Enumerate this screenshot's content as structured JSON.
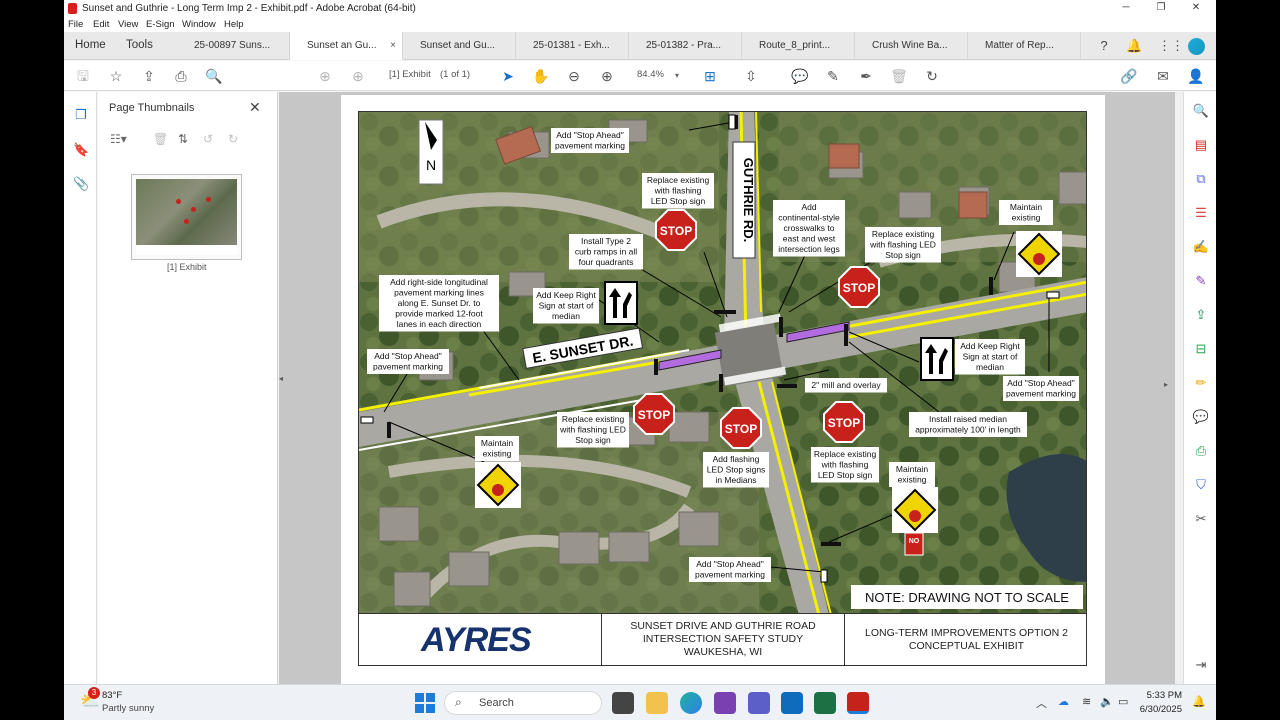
{
  "window": {
    "title": "Sunset and Guthrie - Long Term Imp 2 - Exhibit.pdf - Adobe Acrobat (64-bit)",
    "minimize": "─",
    "maximize": "❐",
    "close": "✕"
  },
  "menu": [
    "File",
    "Edit",
    "View",
    "E-Sign",
    "Window",
    "Help"
  ],
  "nav": {
    "home": "Home",
    "tools": "Tools"
  },
  "tabs": [
    {
      "label": "25-00897 Suns..."
    },
    {
      "label": "Sunset an Gu...",
      "active": true,
      "close": "×"
    },
    {
      "label": "Sunset and Gu..."
    },
    {
      "label": "25-01381 - Exh..."
    },
    {
      "label": "25-01382 - Pra..."
    },
    {
      "label": "Route_8_print..."
    },
    {
      "label": "Crush Wine Ba..."
    },
    {
      "label": "Matter of Rep..."
    }
  ],
  "toolbar": {
    "page_label": "[1] Exhibit",
    "page_count": "(1 of 1)",
    "zoom": "84.4%"
  },
  "thumbnails": {
    "header": "Page Thumbnails",
    "close": "✕",
    "caption": "[1] Exhibit"
  },
  "drawing": {
    "north": "N",
    "road_ns": "GUTHRIE RD.",
    "road_ew": "E. SUNSET DR.",
    "stop": "STOP",
    "no_label": "NO",
    "note": "NOTE: DRAWING NOT TO SCALE",
    "callouts": {
      "stop_ahead_top": [
        "Add \"Stop Ahead\"",
        "pavement marking"
      ],
      "replace_top": [
        "Replace existing",
        "with flashing",
        "LED Stop sign"
      ],
      "continental": [
        "Add",
        "continental-style",
        "crosswalks to",
        "east and west",
        "intersection legs"
      ],
      "replace_ne": [
        "Replace existing",
        "with flashing LED",
        "Stop sign"
      ],
      "maintain_ne": [
        "Maintain",
        "existing"
      ],
      "curb_ramps": [
        "Install Type 2",
        "curb ramps in all",
        "four quadrants"
      ],
      "right_side": [
        "Add right-side longitudinal",
        "pavement marking lines",
        "along E. Sunset Dr. to",
        "provide marked 12-foot",
        "lanes in each direction"
      ],
      "keep_right_w": [
        "Add Keep Right",
        "Sign at start of",
        "median"
      ],
      "stop_ahead_w": [
        "Add \"Stop Ahead\"",
        "pavement marking"
      ],
      "keep_right_e": [
        "Add Keep Right",
        "Sign at start of",
        "median"
      ],
      "stop_ahead_e": [
        "Add \"Stop Ahead\"",
        "pavement marking"
      ],
      "mill_overlay": [
        "2\" mill and overlay"
      ],
      "raised_median": [
        "Install raised median",
        "approximately 100' in length"
      ],
      "replace_sw": [
        "Replace existing",
        "with flashing LED",
        "Stop sign"
      ],
      "maintain_sw": [
        "Maintain",
        "existing"
      ],
      "flashing_medians": [
        "Add flashing",
        "LED Stop signs",
        "in Medians"
      ],
      "replace_se": [
        "Replace existing",
        "with flashing",
        "LED Stop sign"
      ],
      "maintain_se": [
        "Maintain",
        "existing"
      ],
      "stop_ahead_s": [
        "Add \"Stop Ahead\"",
        "pavement marking"
      ]
    }
  },
  "titleblock": {
    "logo": "AYRES",
    "study": [
      "SUNSET DRIVE AND GUTHRIE ROAD",
      "INTERSECTION SAFETY STUDY",
      "WAUKESHA, WI"
    ],
    "option": [
      "LONG-TERM IMPROVEMENTS OPTION 2",
      "CONCEPTUAL EXHIBIT"
    ]
  },
  "taskbar": {
    "weather_temp": "83°F",
    "weather_desc": "Partly sunny",
    "weather_badge": "3",
    "search": "Search",
    "time": "5:33 PM",
    "date": "6/30/2025"
  },
  "colors": {
    "stop": "#c8201b",
    "yellow_line": "#f5f000",
    "median": "#b36be0",
    "acrobat_red": "#d4211a"
  }
}
